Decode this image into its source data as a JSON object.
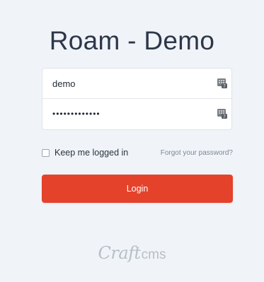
{
  "page": {
    "title": "Roam - Demo"
  },
  "login_form": {
    "username_value": "demo",
    "password_value": "•••••••••••••",
    "remember_label": "Keep me logged in",
    "remember_checked": false,
    "forgot_link": "Forgot your password?",
    "login_button": "Login"
  },
  "footer": {
    "logo_craft": "Craft",
    "logo_cms": "cms"
  },
  "colors": {
    "background": "#f0f4f8",
    "accent": "#e5422b",
    "text": "#29323d",
    "muted": "#7b8794"
  },
  "icons": {
    "username_field_icon": "password-manager-keypad-icon",
    "password_field_icon": "password-manager-keypad-icon"
  }
}
